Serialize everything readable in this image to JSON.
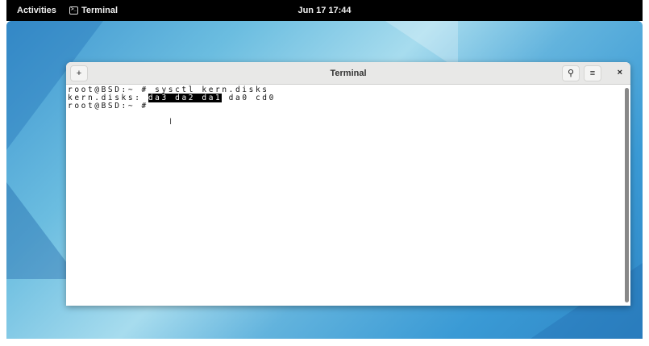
{
  "topbar": {
    "activities": "Activities",
    "app_name": "Terminal",
    "clock": "Jun 17  17:44"
  },
  "window": {
    "title": "Terminal",
    "new_tab_icon": "+",
    "search_icon": "⚲",
    "menu_icon": "≡",
    "close_icon": "×"
  },
  "terminal": {
    "line1": "root@BSD:~ # sysctl kern.disks",
    "line2_prefix": "kern.disks: ",
    "line2_selected": "da3 da2 da1",
    "line2_rest": " da0 cd0",
    "line3": "root@BSD:~ #"
  }
}
